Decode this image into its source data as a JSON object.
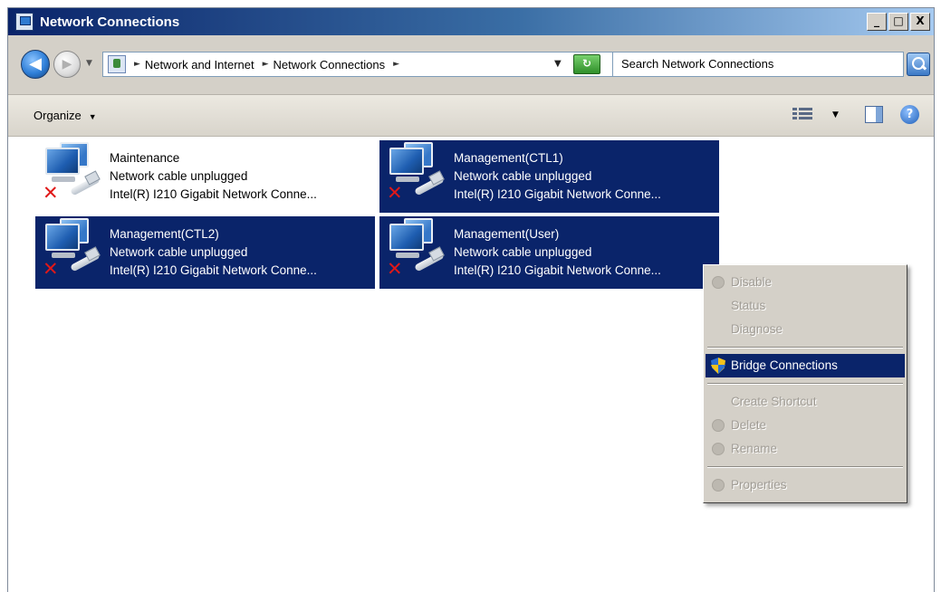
{
  "window": {
    "title": "Network Connections",
    "buttons": {
      "minimize": "_",
      "maximize": "□",
      "close": "X"
    }
  },
  "address_bar": {
    "breadcrumbs": [
      "Network and Internet",
      "Network Connections"
    ],
    "search_placeholder": "Search Network Connections"
  },
  "command_bar": {
    "organize": "Organize"
  },
  "connections": [
    {
      "name": "Maintenance",
      "status": "Network cable unplugged",
      "device": "Intel(R) I210 Gigabit Network Conne...",
      "selected": false
    },
    {
      "name": "Management(CTL1)",
      "status": "Network cable unplugged",
      "device": "Intel(R) I210 Gigabit Network Conne...",
      "selected": true
    },
    {
      "name": "Management(CTL2)",
      "status": "Network cable unplugged",
      "device": "Intel(R) I210 Gigabit Network Conne...",
      "selected": true
    },
    {
      "name": "Management(User)",
      "status": "Network cable unplugged",
      "device": "Intel(R) I210 Gigabit Network Conne...",
      "selected": true
    }
  ],
  "context_menu": {
    "items": [
      {
        "label": "Disable",
        "state": "disabled",
        "icon": "disabled-shield-icon"
      },
      {
        "label": "Status",
        "state": "disabled"
      },
      {
        "label": "Diagnose",
        "state": "disabled"
      },
      {
        "label": "Bridge Connections",
        "state": "highlighted",
        "icon": "uac-shield-icon"
      },
      {
        "label": "Create Shortcut",
        "state": "disabled"
      },
      {
        "label": "Delete",
        "state": "disabled",
        "icon": "disabled-shield-icon"
      },
      {
        "label": "Rename",
        "state": "disabled",
        "icon": "disabled-shield-icon"
      },
      {
        "label": "Properties",
        "state": "disabled",
        "icon": "disabled-shield-icon"
      }
    ]
  },
  "colors": {
    "selection": "#0a246a",
    "menu_background": "#d4d0c8",
    "unplugged_x": "#e01818"
  }
}
